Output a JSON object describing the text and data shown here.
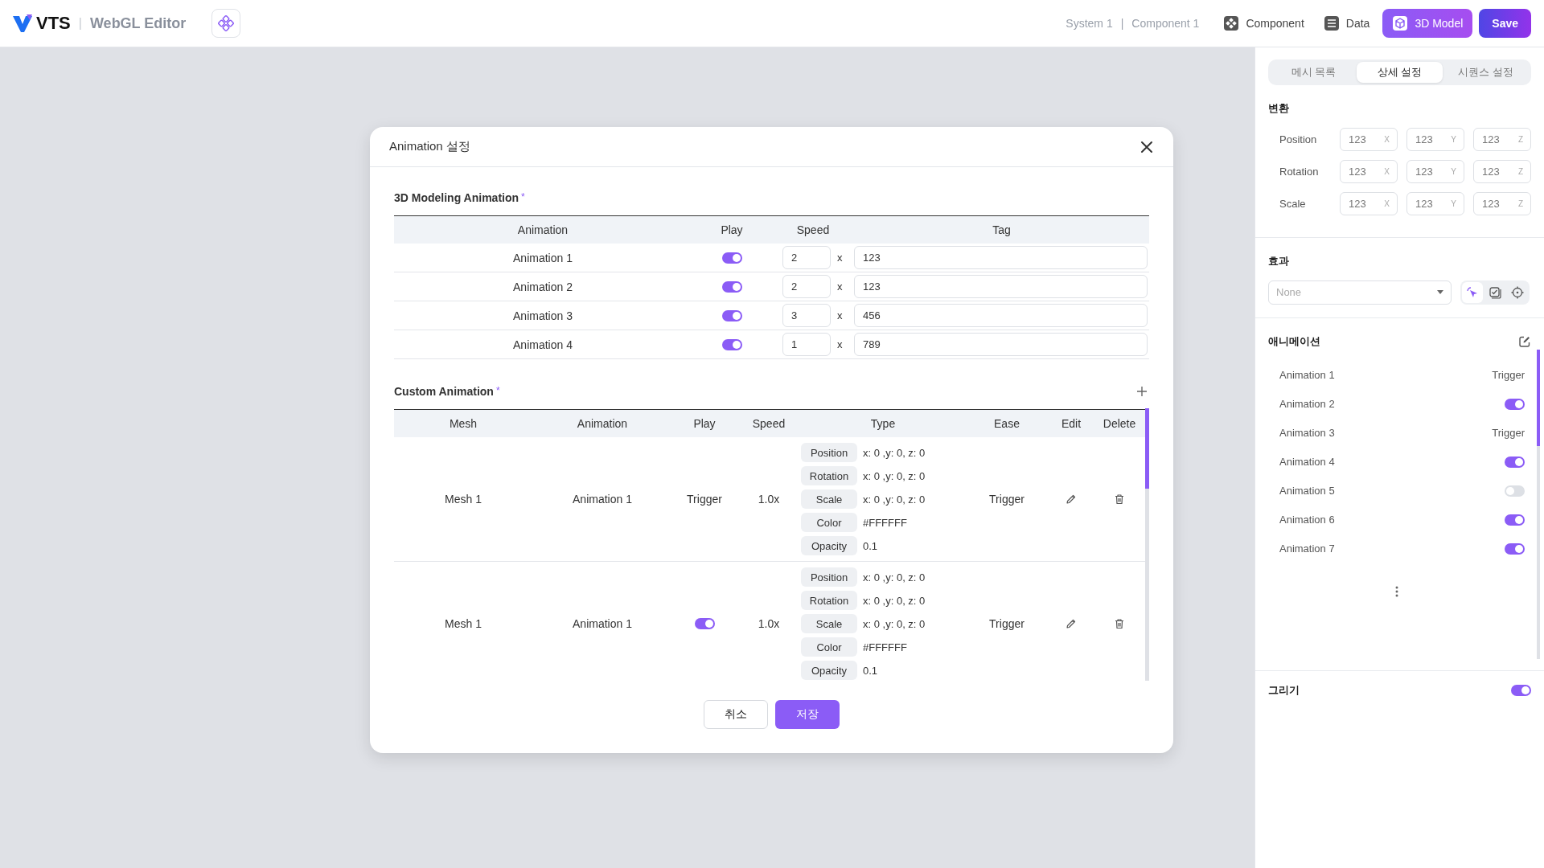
{
  "header": {
    "logo": "VTS",
    "app_title": "WebGL Editor",
    "breadcrumb": [
      "System 1",
      "Component 1"
    ],
    "separator": "|",
    "nav": [
      {
        "label": "Component",
        "kind": "component",
        "selected": false
      },
      {
        "label": "Data",
        "kind": "data",
        "selected": false
      },
      {
        "label": "3D Model",
        "kind": "model",
        "selected": true
      }
    ],
    "save": "Save"
  },
  "modal": {
    "title": "Animation 설정",
    "modeling": {
      "title": "3D Modeling Animation",
      "mark": "*",
      "columns": [
        "Animation",
        "Play",
        "Speed",
        "Tag"
      ],
      "rows": [
        {
          "animation": "Animation 1",
          "play": true,
          "speed": "2",
          "unit": "x",
          "tag": "123"
        },
        {
          "animation": "Animation 2",
          "play": true,
          "speed": "2",
          "unit": "x",
          "tag": "123"
        },
        {
          "animation": "Animation 3",
          "play": true,
          "speed": "3",
          "unit": "x",
          "tag": "456"
        },
        {
          "animation": "Animation 4",
          "play": true,
          "speed": "1",
          "unit": "x",
          "tag": "789"
        }
      ]
    },
    "custom": {
      "title": "Custom Animation",
      "mark": "*",
      "columns": [
        "Mesh",
        "Animation",
        "Play",
        "Speed",
        "Type",
        "Ease",
        "Edit",
        "Delete"
      ],
      "rows": [
        {
          "mesh": "Mesh 1",
          "animation": "Animation 1",
          "play": {
            "kind": "text",
            "text": "Trigger"
          },
          "speed": "1.0x",
          "types": [
            {
              "label": "Position",
              "value": "x: 0 ,y: 0, z: 0"
            },
            {
              "label": "Rotation",
              "value": "x: 0 ,y: 0, z: 0"
            },
            {
              "label": "Scale",
              "value": "x: 0 ,y: 0, z: 0"
            },
            {
              "label": "Color",
              "value": "#FFFFFF"
            },
            {
              "label": "Opacity",
              "value": "0.1"
            }
          ],
          "ease": "Trigger"
        },
        {
          "mesh": "Mesh 1",
          "animation": "Animation 1",
          "play": {
            "kind": "toggle",
            "on": true
          },
          "speed": "1.0x",
          "types": [
            {
              "label": "Position",
              "value": "x: 0 ,y: 0, z: 0"
            },
            {
              "label": "Rotation",
              "value": "x: 0 ,y: 0, z: 0"
            },
            {
              "label": "Scale",
              "value": "x: 0 ,y: 0, z: 0"
            },
            {
              "label": "Color",
              "value": "#FFFFFF"
            },
            {
              "label": "Opacity",
              "value": "0.1"
            }
          ],
          "ease": "Trigger"
        }
      ]
    },
    "buttons": [
      {
        "label": "취소",
        "kind": "secondary"
      },
      {
        "label": "저장",
        "kind": "primary"
      }
    ]
  },
  "panel": {
    "tabs": [
      {
        "label": "메시 목록",
        "selected": false
      },
      {
        "label": "상세 설정",
        "selected": true
      },
      {
        "label": "시퀀스 설정",
        "selected": false
      }
    ],
    "transform": {
      "title": "변환",
      "rows": [
        {
          "label": "Position",
          "values": [
            {
              "value": "123",
              "axis": "X"
            },
            {
              "value": "123",
              "axis": "Y"
            },
            {
              "value": "123",
              "axis": "Z"
            }
          ]
        },
        {
          "label": "Rotation",
          "values": [
            {
              "value": "123",
              "axis": "X"
            },
            {
              "value": "123",
              "axis": "Y"
            },
            {
              "value": "123",
              "axis": "Z"
            }
          ]
        },
        {
          "label": "Scale",
          "values": [
            {
              "value": "123",
              "axis": "X"
            },
            {
              "value": "123",
              "axis": "Y"
            },
            {
              "value": "123",
              "axis": "Z"
            }
          ]
        }
      ]
    },
    "effect": {
      "title": "효과",
      "placeholder": "None",
      "tools": [
        {
          "kind": "cursor",
          "selected": true
        },
        {
          "kind": "checkbox",
          "selected": false
        },
        {
          "kind": "target",
          "selected": false
        }
      ]
    },
    "animation": {
      "title": "애니메이션",
      "items": [
        {
          "label": "Animation 1",
          "kind": "text",
          "text": "Trigger"
        },
        {
          "label": "Animation 2",
          "kind": "toggle",
          "on": true
        },
        {
          "label": "Animation 3",
          "kind": "text",
          "text": "Trigger"
        },
        {
          "label": "Animation 4",
          "kind": "toggle",
          "on": true
        },
        {
          "label": "Animation 5",
          "kind": "toggle",
          "on": false
        },
        {
          "label": "Animation 6",
          "kind": "toggle",
          "on": true
        },
        {
          "label": "Animation 7",
          "kind": "toggle",
          "on": true
        }
      ]
    },
    "draw": {
      "title": "그리기",
      "on": true
    }
  }
}
